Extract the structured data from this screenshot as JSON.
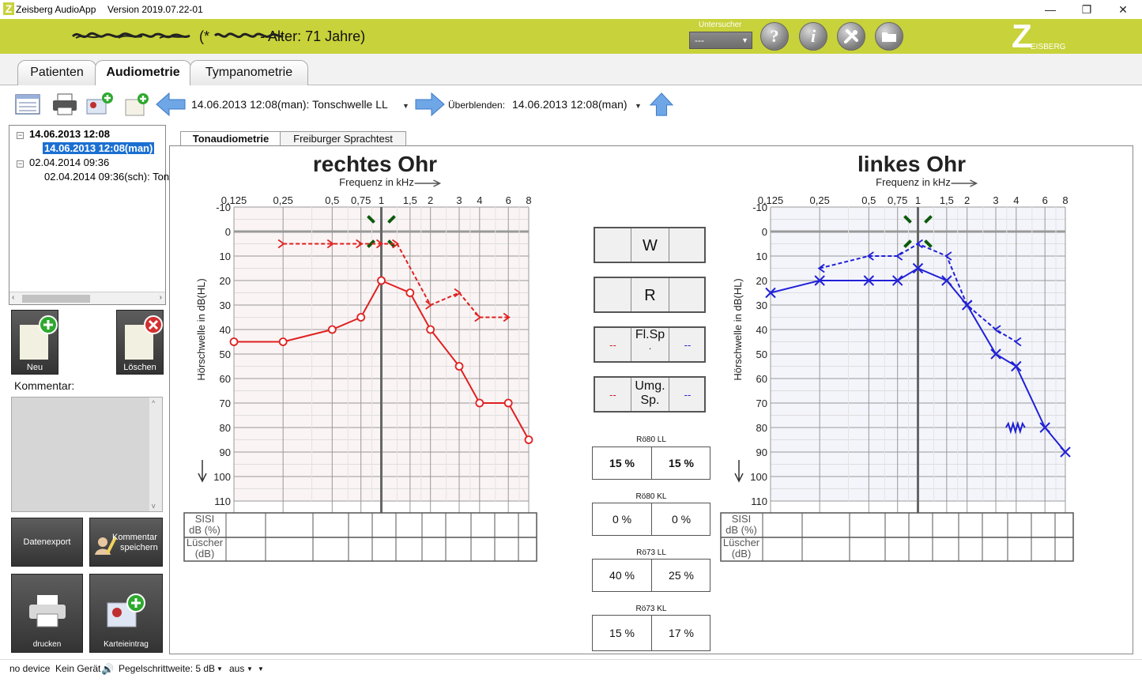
{
  "window": {
    "app_name": "Zeisberg AudioApp",
    "version": "Version 2019.07.22-01",
    "minimize": "—",
    "maximize": "❐",
    "close": "✕"
  },
  "header": {
    "patient_title": "(*                 - Alter: 71 Jahre)",
    "untersucher_label": "Untersucher",
    "untersucher_value": "---",
    "help_label": "?",
    "info_label": "i",
    "logo_text": "EISBERG"
  },
  "main_tabs": [
    {
      "label": "Patienten"
    },
    {
      "label": "Audiometrie"
    },
    {
      "label": "Tympanometrie"
    }
  ],
  "toolbar": {
    "measurement": "14.06.2013 12:08(man): Tonschwelle LL",
    "overlay_label": "Überblenden:",
    "overlay_value": "14.06.2013 12:08(man)"
  },
  "tree": {
    "items": [
      {
        "label": "14.06.2013 12:08"
      },
      {
        "label": "14.06.2013 12:08(man)"
      },
      {
        "label": "02.04.2014 09:36"
      },
      {
        "label": "02.04.2014 09:36(sch): Ton"
      }
    ]
  },
  "left_buttons": {
    "new": "Neu",
    "delete": "Löschen",
    "comment_label": "Kommentar:",
    "export": "Datenexport",
    "save_comment_1": "Kommentar",
    "save_comment_2": "speichern",
    "print": "drucken",
    "file_entry": "Karteieintrag"
  },
  "sub_tabs": [
    {
      "label": "Tonaudiometrie"
    },
    {
      "label": "Freiburger Sprachtest"
    }
  ],
  "chart_data": [
    {
      "type": "line",
      "title": "rechtes Ohr",
      "xlabel": "Frequenz in kHz",
      "ylabel": "Hörschwelle in dB(HL)",
      "x_ticks": [
        "0,125",
        "0,25",
        "0,5",
        "0,75",
        "1",
        "1,5",
        "2",
        "3",
        "4",
        "6",
        "8"
      ],
      "y_ticks": [
        "-10",
        "0",
        "10",
        "20",
        "30",
        "40",
        "50",
        "60",
        "70",
        "80",
        "90",
        "100",
        "110"
      ],
      "ylim": [
        -10,
        110
      ],
      "series": [
        {
          "color": "#e02020",
          "style": "solid",
          "marker": "circle",
          "x": [
            "0,125",
            "0,25",
            "0,5",
            "0,75",
            "1",
            "1,5",
            "2",
            "3",
            "4",
            "6",
            "8"
          ],
          "values": [
            45,
            45,
            40,
            35,
            20,
            25,
            40,
            55,
            70,
            70,
            85
          ]
        },
        {
          "color": "#e02020",
          "style": "dashed",
          "marker": "bracket-right",
          "points": [
            [
              "0,25",
              5
            ],
            [
              "0,5",
              5
            ],
            [
              "0,75",
              5
            ],
            [
              "1",
              5
            ],
            [
              "1,25",
              5
            ],
            [
              "2",
              30
            ],
            [
              "3",
              25
            ],
            [
              "4",
              35
            ],
            [
              "6",
              35
            ]
          ]
        }
      ],
      "table_rows": [
        "SISI dB (%)",
        "Lüscher (dB)"
      ]
    },
    {
      "type": "line",
      "title": "linkes Ohr",
      "xlabel": "Frequenz in kHz",
      "ylabel": "Hörschwelle in dB(HL)",
      "x_ticks": [
        "0,125",
        "0,25",
        "0,5",
        "0,75",
        "1",
        "1,5",
        "2",
        "3",
        "4",
        "6",
        "8"
      ],
      "y_ticks": [
        "-10",
        "0",
        "10",
        "20",
        "30",
        "40",
        "50",
        "60",
        "70",
        "80",
        "90",
        "100",
        "110"
      ],
      "ylim": [
        -10,
        110
      ],
      "series": [
        {
          "color": "#2020d8",
          "style": "solid",
          "marker": "cross",
          "x": [
            "0,125",
            "0,25",
            "0,5",
            "0,75",
            "1",
            "1,5",
            "2",
            "3",
            "4",
            "6",
            "8"
          ],
          "values": [
            25,
            20,
            20,
            20,
            15,
            20,
            30,
            50,
            55,
            80,
            90
          ]
        },
        {
          "color": "#2020d8",
          "style": "dashed",
          "marker": "bracket-left",
          "points": [
            [
              "0,25",
              15
            ],
            [
              "0,5",
              10
            ],
            [
              "0,75",
              10
            ],
            [
              "1",
              5
            ],
            [
              "1,5",
              10
            ],
            [
              "2",
              30
            ],
            [
              "3",
              40
            ],
            [
              "4",
              45
            ]
          ]
        }
      ],
      "table_rows": [
        "SISI dB (%)",
        "Lüscher (dB)"
      ]
    }
  ],
  "center": {
    "w_label": "W",
    "r_label": "R",
    "flsp_1": "Fl.Sp",
    "flsp_2": ".",
    "umg_1": "Umg.",
    "umg_2": "Sp.",
    "dash": "--",
    "ro80ll_label": "Rö80 LL",
    "ro80ll_r": "15 %",
    "ro80ll_l": "15 %",
    "ro80kl_label": "Rö80 KL",
    "ro80kl_r": "0 %",
    "ro80kl_l": "0 %",
    "ro73ll_label": "Rö73 LL",
    "ro73ll_r": "40 %",
    "ro73ll_l": "25 %",
    "ro73kl_label": "Rö73 KL",
    "ro73kl_r": "15 %",
    "ro73kl_l": "17 %"
  },
  "status": {
    "device": "no device",
    "device2": "Kein Gerät",
    "step": "Pegelschrittweite: 5 dB",
    "mode": "aus"
  },
  "colors": {
    "header": "#c8d23a",
    "right_ear": "#e02020",
    "left_ear": "#2020d8",
    "masking": "#0a5a0a"
  }
}
